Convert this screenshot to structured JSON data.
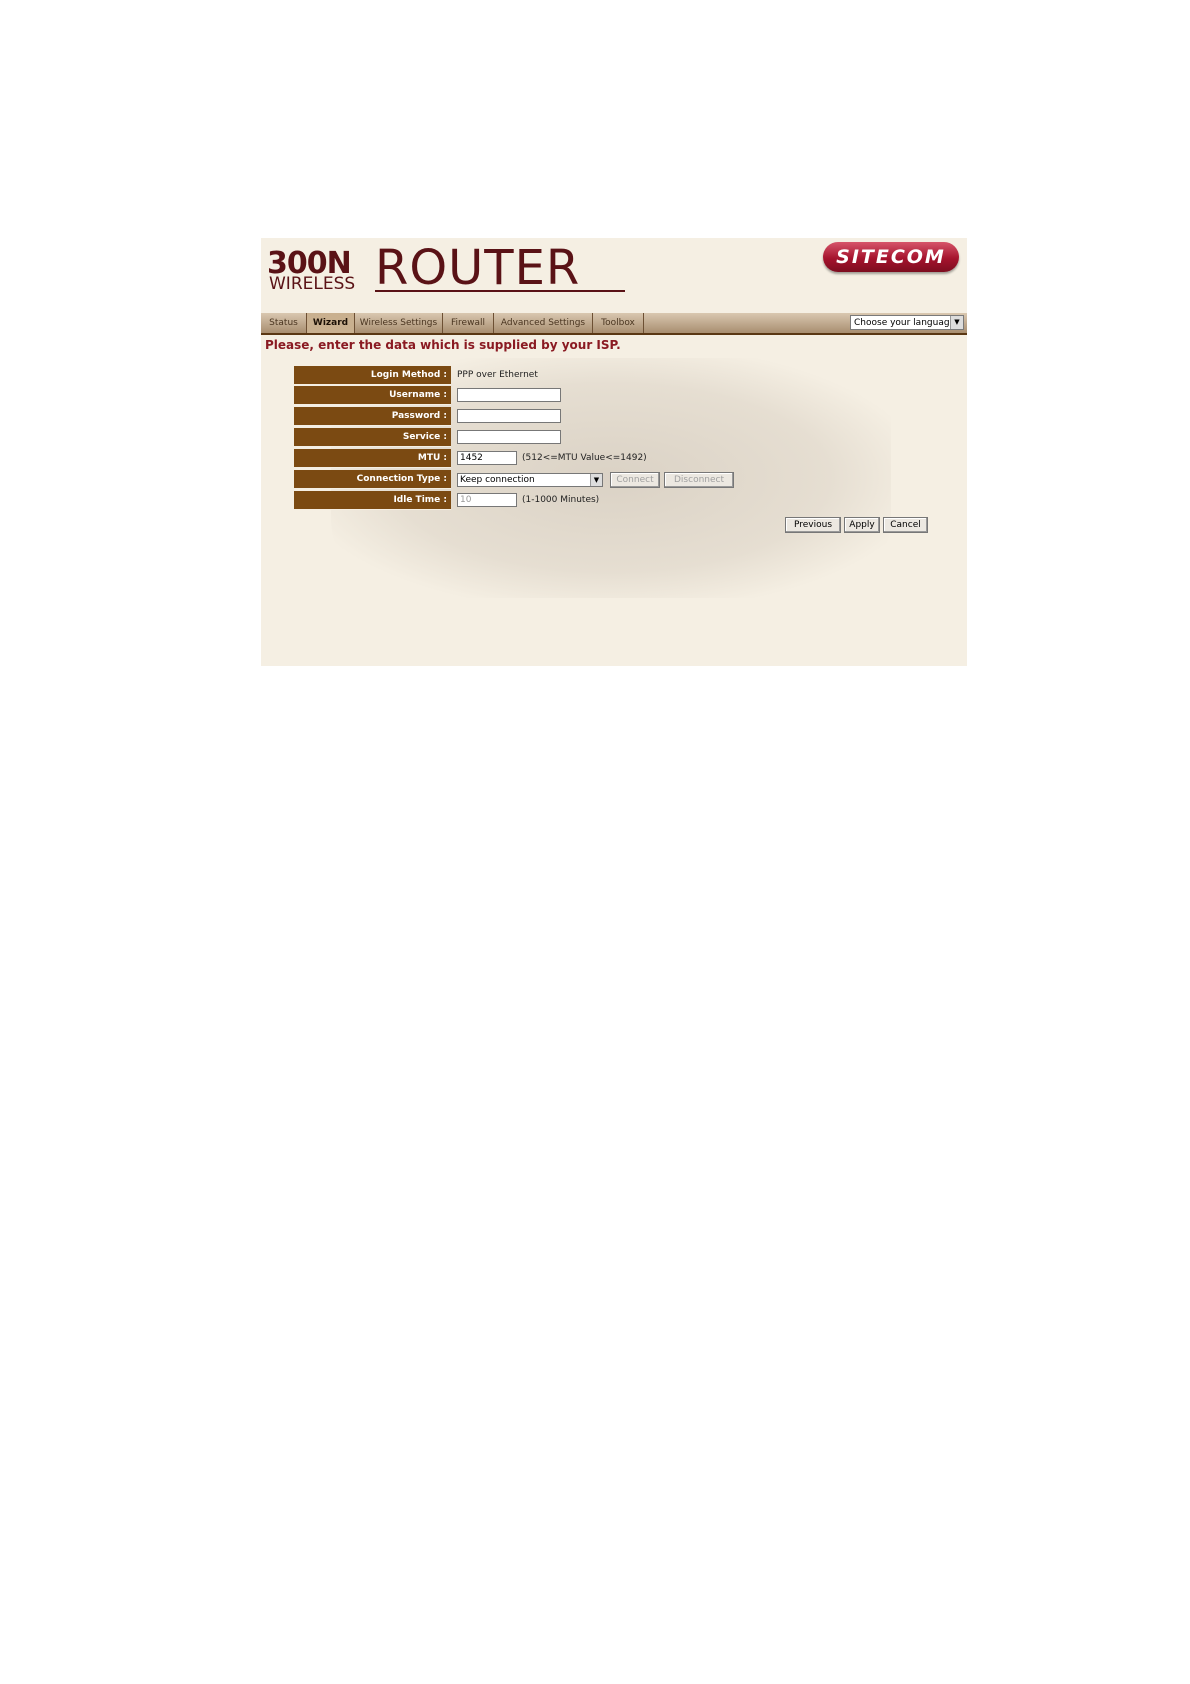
{
  "header": {
    "logo_300n": "300N",
    "logo_wireless": "WIRELESS",
    "logo_router": "ROUTER",
    "brand": "SITECOM"
  },
  "nav": {
    "tabs": [
      "Status",
      "Wizard",
      "Wireless Settings",
      "Firewall",
      "Advanced Settings",
      "Toolbox"
    ],
    "active_tab": "Wizard",
    "language_select": "Choose your language"
  },
  "main": {
    "heading": "Please, enter the data which is supplied by your ISP.",
    "fields": {
      "login_method_label": "Login Method :",
      "login_method_value": "PPP over Ethernet",
      "username_label": "Username :",
      "username_value": "",
      "password_label": "Password :",
      "password_value": "",
      "service_label": "Service :",
      "service_value": "",
      "mtu_label": "MTU :",
      "mtu_value": "1452",
      "mtu_hint": "(512<=MTU Value<=1492)",
      "connection_type_label": "Connection Type :",
      "connection_type_value": "Keep connection",
      "connect_button": "Connect",
      "disconnect_button": "Disconnect",
      "idle_time_label": "Idle Time :",
      "idle_time_value": "10",
      "idle_time_hint": "(1-1000 Minutes)"
    },
    "buttons": {
      "previous": "Previous",
      "apply": "Apply",
      "cancel": "Cancel"
    }
  },
  "colors": {
    "label_bg": "#7b4a12",
    "heading": "#8a1a22",
    "panel_bg": "#f5efe3"
  }
}
